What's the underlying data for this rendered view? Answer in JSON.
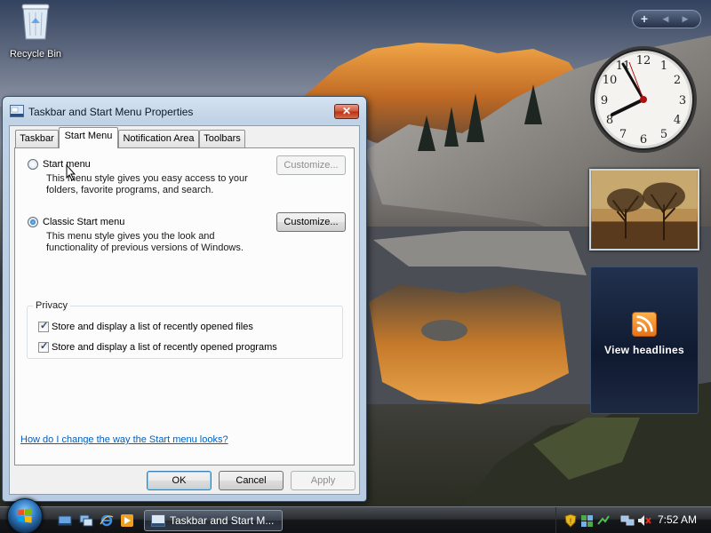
{
  "desktop": {
    "recycle_bin_label": "Recycle Bin"
  },
  "sidebar": {
    "add_symbol": "+",
    "prev_symbol": "◀",
    "next_symbol": "▶",
    "feeds_caption": "View headlines"
  },
  "dialog": {
    "title": "Taskbar and Start Menu Properties",
    "close_symbol": "✕",
    "tabs": [
      {
        "label": "Taskbar",
        "active": false
      },
      {
        "label": "Start Menu",
        "active": true
      },
      {
        "label": "Notification Area",
        "active": false
      },
      {
        "label": "Toolbars",
        "active": false
      }
    ],
    "start_menu_option": {
      "label": "Start menu",
      "selected": false,
      "description_line1": "This menu style gives you easy access to your",
      "description_line2": "folders, favorite programs, and search.",
      "customize_label": "Customize...",
      "customize_enabled": false
    },
    "classic_option": {
      "label": "Classic Start menu",
      "selected": true,
      "description_line1": "This menu style gives you the look and",
      "description_line2": "functionality of previous versions of Windows.",
      "customize_label": "Customize...",
      "customize_enabled": true
    },
    "privacy": {
      "title": "Privacy",
      "items": [
        {
          "label": "Store and display a list of recently opened files",
          "checked": true
        },
        {
          "label": "Store and display a list of recently opened programs",
          "checked": true
        }
      ]
    },
    "help_link": "How do I change the way the Start menu looks?",
    "ok_label": "OK",
    "cancel_label": "Cancel",
    "apply_label": "Apply"
  },
  "taskbar": {
    "active_window_label": "Taskbar and Start M...",
    "time": "7:52 AM"
  },
  "colors": {
    "link": "#0060c0",
    "close_button": "#c8452a",
    "rss_orange": "#f0902c"
  }
}
